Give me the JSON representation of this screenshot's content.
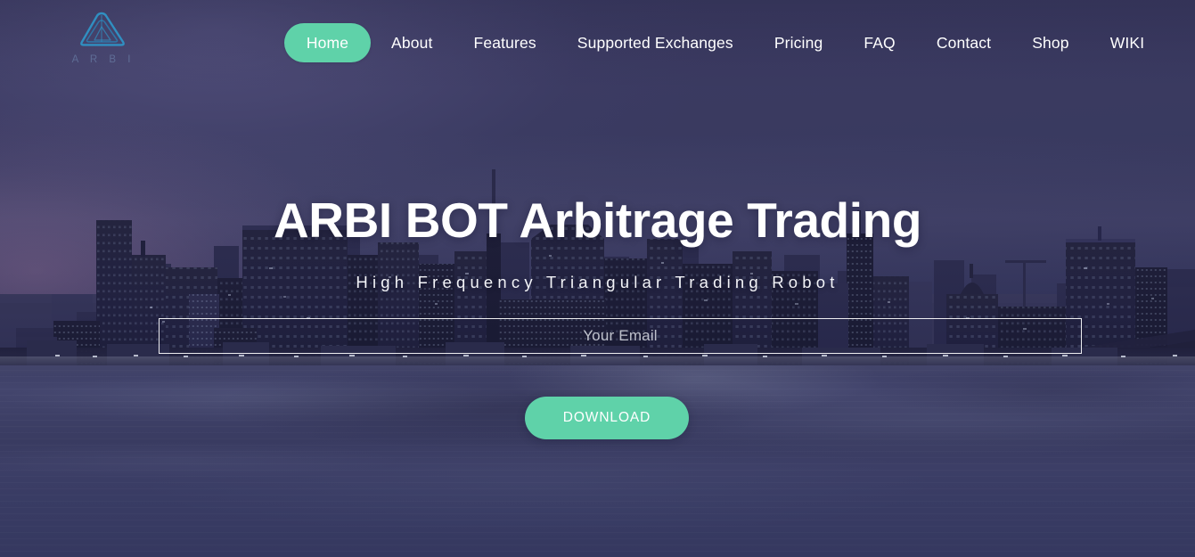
{
  "brand": {
    "logo_icon": "arbi-triangle-logo",
    "logo_wordmark": "A R B I"
  },
  "nav": {
    "items": [
      {
        "label": "Home",
        "active": true
      },
      {
        "label": "About",
        "active": false
      },
      {
        "label": "Features",
        "active": false
      },
      {
        "label": "Supported Exchanges",
        "active": false
      },
      {
        "label": "Pricing",
        "active": false
      },
      {
        "label": "FAQ",
        "active": false
      },
      {
        "label": "Contact",
        "active": false
      },
      {
        "label": "Shop",
        "active": false
      },
      {
        "label": "WIKI",
        "active": false
      }
    ]
  },
  "hero": {
    "title": "ARBI BOT Arbitrage Trading",
    "subtitle": "High Frequency Triangular Trading Robot",
    "email": {
      "placeholder": "Your Email",
      "value": ""
    },
    "download_label": "DOWNLOAD"
  },
  "colors": {
    "accent_green": "#5fd2a9",
    "sky_indigo": "#3b3a61",
    "water_blue": "#3d3f66",
    "logo_cyan": "#2f93c6",
    "text_white": "#ffffff"
  }
}
